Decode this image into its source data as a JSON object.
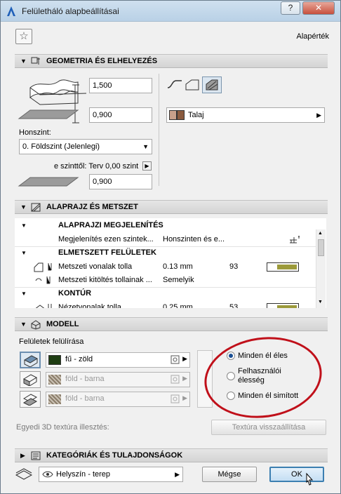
{
  "window": {
    "title": "Felületháló alapbeállításai",
    "help_label": "?",
    "close_label": "✕",
    "default_label": "Alapérték"
  },
  "geometry": {
    "section_title": "GEOMETRIA ÉS ELHELYEZÉS",
    "height_value": "1,500",
    "base_value": "0,900",
    "story_label": "Honszint:",
    "story_value": "0. Földszint (Jelenlegi)",
    "offset_label": "e szinttől: Terv 0,00 szint",
    "offset_value": "0,900",
    "material_label": "Talaj"
  },
  "floorplan": {
    "section_title": "ALAPRAJZ ÉS METSZET",
    "groups": [
      {
        "title": "ALAPRAJZI MEGJELENÍTÉS",
        "rows": [
          {
            "name": "Megjelenítés ezen szintek...",
            "value": "Honszinten és e...",
            "extra": ""
          }
        ]
      },
      {
        "title": "ELMETSZETT FELÜLETEK",
        "rows": [
          {
            "name": "Metszeti vonalak tolla",
            "value": "0.13 mm",
            "extra": "93"
          },
          {
            "name": "Metszeti kitöltés tollainak ...",
            "value": "Semelyik",
            "extra": ""
          }
        ]
      },
      {
        "title": "KONTÚR",
        "rows": [
          {
            "name": "Nézetvonalak tolla",
            "value": "0.25 mm",
            "extra": "53"
          }
        ]
      }
    ]
  },
  "model": {
    "section_title": "MODELL",
    "override_label": "Felületek felülírása",
    "surfaces": [
      {
        "label": "fű - zöld",
        "color": "#1e3d12",
        "enabled": true
      },
      {
        "label": "föld - barna",
        "color": "#8a7d6a",
        "enabled": false
      },
      {
        "label": "föld - barna",
        "color": "#8a7d6a",
        "enabled": false
      }
    ],
    "edge_options": [
      {
        "label": "Minden él éles",
        "selected": true
      },
      {
        "label": "Felhasználói élesség",
        "selected": false
      },
      {
        "label": "Minden él simított",
        "selected": false
      }
    ],
    "texture_label": "Egyedi 3D textúra illesztés:",
    "texture_reset_label": "Textúra visszaállítása"
  },
  "categories": {
    "section_title": "KATEGÓRIÁK ÉS TULAJDONSÁGOK"
  },
  "footer": {
    "layer_value": "Helyszín - terep",
    "cancel_label": "Mégse",
    "ok_label": "OK"
  },
  "colors": {
    "pen_swatch": "#9c9a3a",
    "annotation_ellipse": "#c0101a"
  }
}
